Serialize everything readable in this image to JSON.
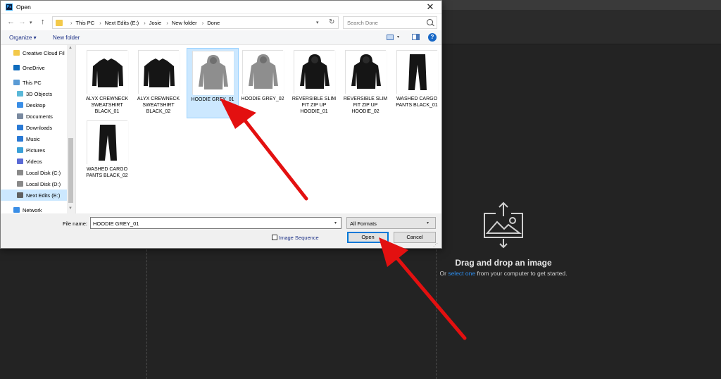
{
  "app": {
    "drop_title": "Drag and drop an image",
    "drop_sub_prefix": "Or ",
    "drop_sub_link": "select one",
    "drop_sub_suffix": " from your computer to get started.",
    "drop_icon": "image-upload-icon"
  },
  "dialog": {
    "title": "Open",
    "app_icon_text": "Ps",
    "close_label": "✕",
    "nav": {
      "back": "←",
      "forward": "→",
      "recent": "▾",
      "up": "↑"
    },
    "breadcrumb": [
      "This PC",
      "Next Edits (E:)",
      "Josie",
      "New folder",
      "Done"
    ],
    "search_placeholder": "Search Done",
    "toolbar": {
      "organize": "Organize ▾",
      "new_folder": "New folder",
      "help": "?"
    },
    "sidebar": [
      {
        "label": "Creative Cloud Fil",
        "icon": "folder-icon",
        "color": "#f3c94a"
      },
      {
        "label": "OneDrive",
        "icon": "cloud-icon",
        "color": "#0f6cbd"
      },
      {
        "label": "This PC",
        "icon": "computer-icon",
        "color": "#5a9bd5"
      },
      {
        "label": "3D Objects",
        "icon": "cube-icon",
        "color": "#5ab8d8"
      },
      {
        "label": "Desktop",
        "icon": "desktop-icon",
        "color": "#3a8ee6"
      },
      {
        "label": "Documents",
        "icon": "document-icon",
        "color": "#7a8aa0"
      },
      {
        "label": "Downloads",
        "icon": "download-icon",
        "color": "#2a7ad5"
      },
      {
        "label": "Music",
        "icon": "music-icon",
        "color": "#2a7ad5"
      },
      {
        "label": "Pictures",
        "icon": "picture-icon",
        "color": "#3aa0d8"
      },
      {
        "label": "Videos",
        "icon": "video-icon",
        "color": "#5a6ad5"
      },
      {
        "label": "Local Disk (C:)",
        "icon": "drive-icon",
        "color": "#8a8a8a"
      },
      {
        "label": "Local Disk (D:)",
        "icon": "drive-icon",
        "color": "#8a8a8a"
      },
      {
        "label": "Next Edits (E:)",
        "icon": "drive-icon",
        "color": "#606060"
      },
      {
        "label": "Network",
        "icon": "network-icon",
        "color": "#3a8ee6"
      }
    ],
    "files": [
      {
        "name": "ALYX CREWNECK SWEATSHIRT BLACK_01",
        "kind": "sweatshirt"
      },
      {
        "name": "ALYX CREWNECK SWEATSHIRT BLACK_02",
        "kind": "sweatshirt"
      },
      {
        "name": "HOODIE GREY_01",
        "kind": "hoodie-grey",
        "selected": true
      },
      {
        "name": "HOODIE GREY_02",
        "kind": "hoodie-grey"
      },
      {
        "name": "REVERSIBLE SLIM FIT ZIP UP HOODIE_01",
        "kind": "hoodie-black"
      },
      {
        "name": "REVERSIBLE SLIM FIT ZIP UP HOODIE_02",
        "kind": "hoodie-black"
      },
      {
        "name": "WASHED CARGO PANTS BLACK_01",
        "kind": "pants"
      },
      {
        "name": "WASHED CARGO PANTS BLACK_02",
        "kind": "pants"
      }
    ],
    "filename_label": "File name:",
    "filename_value": "HOODIE GREY_01",
    "format_value": "All Formats",
    "image_sequence_label": "Image Sequence",
    "open_label": "Open",
    "cancel_label": "Cancel",
    "dropdown_glyph": "▾"
  },
  "colors": {
    "annotation_arrow": "#e31010",
    "selection": "#cce8ff",
    "link": "#2d8ceb"
  }
}
